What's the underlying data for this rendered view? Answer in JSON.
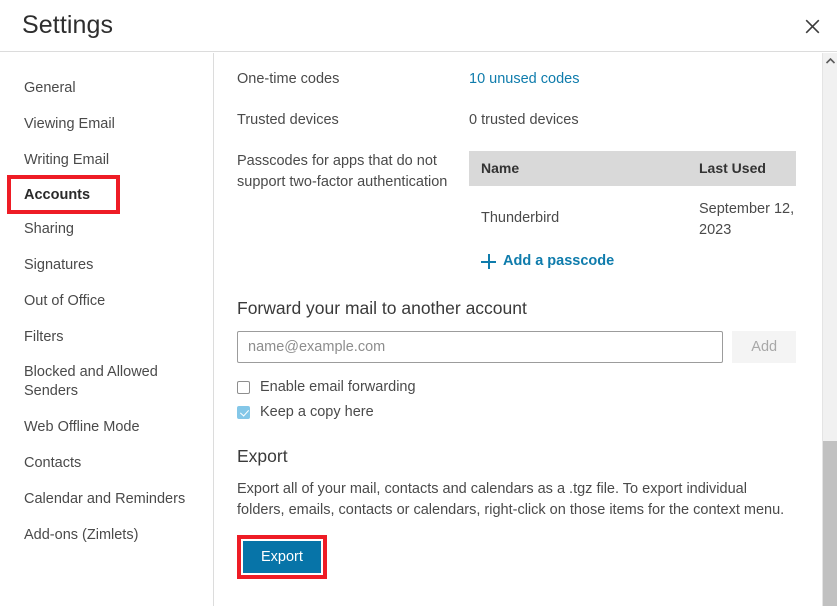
{
  "window": {
    "title": "Settings",
    "close_label": "×"
  },
  "sidebar": {
    "items": [
      {
        "label": "General",
        "selected": false
      },
      {
        "label": "Viewing Email",
        "selected": false
      },
      {
        "label": "Writing Email",
        "selected": false
      },
      {
        "label": "Accounts",
        "selected": true,
        "highlighted": true
      },
      {
        "label": "Sharing",
        "selected": false
      },
      {
        "label": "Signatures",
        "selected": false
      },
      {
        "label": "Out of Office",
        "selected": false
      },
      {
        "label": "Filters",
        "selected": false
      },
      {
        "label": "Blocked and Allowed Senders",
        "selected": false
      },
      {
        "label": "Web Offline Mode",
        "selected": false
      },
      {
        "label": "Contacts",
        "selected": false
      },
      {
        "label": "Calendar and Reminders",
        "selected": false
      },
      {
        "label": "Add-ons (Zimlets)",
        "selected": false
      }
    ]
  },
  "main": {
    "one_time_codes": {
      "label": "One-time codes",
      "value": "10 unused codes"
    },
    "trusted_devices": {
      "label": "Trusted devices",
      "value": "0 trusted devices"
    },
    "passcodes": {
      "label": "Passcodes for apps that do not support two-factor authentication",
      "columns": [
        "Name",
        "Last Used"
      ],
      "rows": [
        {
          "name": "Thunderbird",
          "last_used": "September 12, 2023"
        }
      ],
      "add_link": "Add a passcode"
    },
    "forwarding": {
      "title": "Forward your mail to another account",
      "input_placeholder": "name@example.com",
      "input_value": "",
      "add_button": "Add",
      "enable_checkbox": {
        "label": "Enable email forwarding",
        "checked": false
      },
      "keep_copy_checkbox": {
        "label": "Keep a copy here",
        "checked": true
      }
    },
    "export": {
      "title": "Export",
      "description": "Export all of your mail, contacts and calendars as a .tgz file. To export individual folders, emails, contacts or calendars, right-click on those items for the context menu.",
      "button_label": "Export"
    }
  },
  "colors": {
    "link": "#0f7cac",
    "primary_button": "#0774a8",
    "highlight_outline": "#ee1c25",
    "checkbox_checked": "#84c7e8",
    "table_header_bg": "#d9d9d9"
  }
}
